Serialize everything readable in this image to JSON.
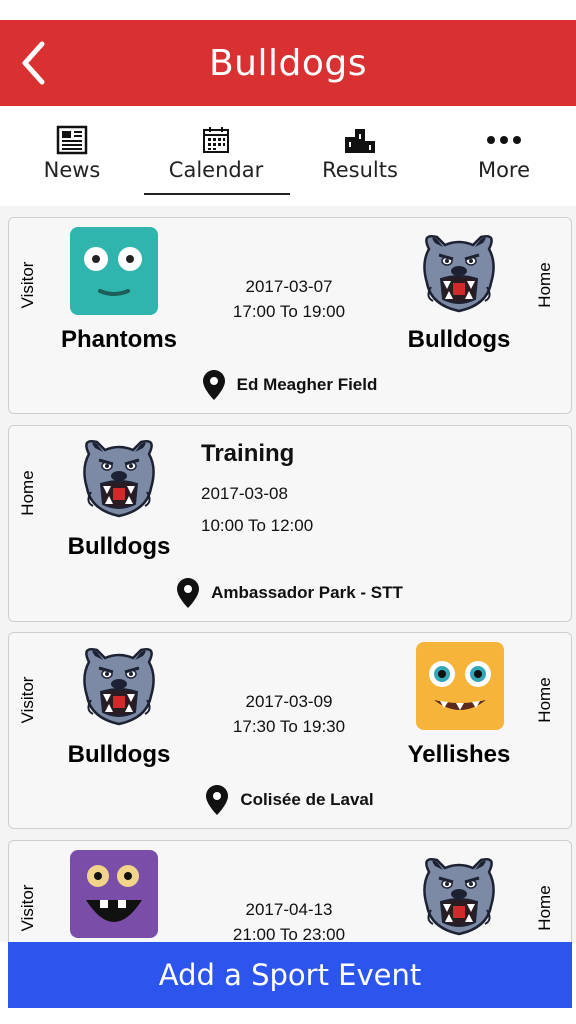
{
  "header": {
    "title": "Bulldogs"
  },
  "tabs": [
    {
      "label": "News",
      "icon": "newspaper-icon"
    },
    {
      "label": "Calendar",
      "icon": "calendar-icon"
    },
    {
      "label": "Results",
      "icon": "podium-icon"
    },
    {
      "label": "More",
      "icon": "more-dots-icon"
    }
  ],
  "events": [
    {
      "left_side": "Visitor",
      "left_team": "Phantoms",
      "right_side": "Home",
      "right_team": "Bulldogs",
      "date": "2017-03-07",
      "time": "17:00 To 19:00",
      "location": "Ed Meagher Field"
    },
    {
      "left_side": "Home",
      "left_team": "Bulldogs",
      "title": "Training",
      "date": "2017-03-08",
      "time": "10:00 To 12:00",
      "location": "Ambassador Park - STT"
    },
    {
      "left_side": "Visitor",
      "left_team": "Bulldogs",
      "right_side": "Home",
      "right_team": "Yellishes",
      "date": "2017-03-09",
      "time": "17:30 To 19:30",
      "location": "Colisée de Laval"
    },
    {
      "left_side": "Visitor",
      "right_side": "Home",
      "date": "2017-04-13",
      "time": "21:00 To 23:00"
    }
  ],
  "add_button": {
    "label": "Add a Sport Event"
  },
  "colors": {
    "header": "#d93131",
    "button": "#2c55ee"
  }
}
